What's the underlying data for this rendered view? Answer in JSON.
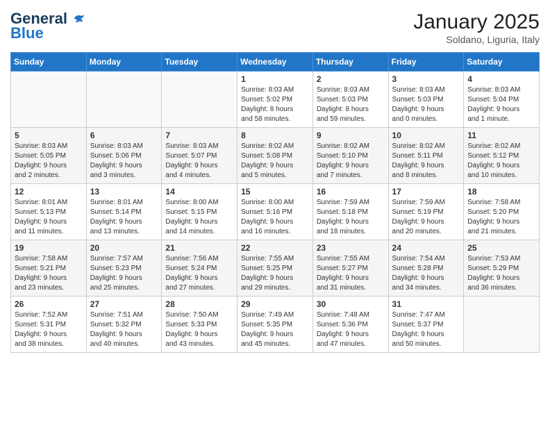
{
  "header": {
    "logo_general": "General",
    "logo_blue": "Blue",
    "month": "January 2025",
    "location": "Soldano, Liguria, Italy"
  },
  "weekdays": [
    "Sunday",
    "Monday",
    "Tuesday",
    "Wednesday",
    "Thursday",
    "Friday",
    "Saturday"
  ],
  "weeks": [
    [
      {
        "day": "",
        "info": ""
      },
      {
        "day": "",
        "info": ""
      },
      {
        "day": "",
        "info": ""
      },
      {
        "day": "1",
        "info": "Sunrise: 8:03 AM\nSunset: 5:02 PM\nDaylight: 8 hours\nand 58 minutes."
      },
      {
        "day": "2",
        "info": "Sunrise: 8:03 AM\nSunset: 5:03 PM\nDaylight: 8 hours\nand 59 minutes."
      },
      {
        "day": "3",
        "info": "Sunrise: 8:03 AM\nSunset: 5:03 PM\nDaylight: 9 hours\nand 0 minutes."
      },
      {
        "day": "4",
        "info": "Sunrise: 8:03 AM\nSunset: 5:04 PM\nDaylight: 9 hours\nand 1 minute."
      }
    ],
    [
      {
        "day": "5",
        "info": "Sunrise: 8:03 AM\nSunset: 5:05 PM\nDaylight: 9 hours\nand 2 minutes."
      },
      {
        "day": "6",
        "info": "Sunrise: 8:03 AM\nSunset: 5:06 PM\nDaylight: 9 hours\nand 3 minutes."
      },
      {
        "day": "7",
        "info": "Sunrise: 8:03 AM\nSunset: 5:07 PM\nDaylight: 9 hours\nand 4 minutes."
      },
      {
        "day": "8",
        "info": "Sunrise: 8:02 AM\nSunset: 5:08 PM\nDaylight: 9 hours\nand 5 minutes."
      },
      {
        "day": "9",
        "info": "Sunrise: 8:02 AM\nSunset: 5:10 PM\nDaylight: 9 hours\nand 7 minutes."
      },
      {
        "day": "10",
        "info": "Sunrise: 8:02 AM\nSunset: 5:11 PM\nDaylight: 9 hours\nand 8 minutes."
      },
      {
        "day": "11",
        "info": "Sunrise: 8:02 AM\nSunset: 5:12 PM\nDaylight: 9 hours\nand 10 minutes."
      }
    ],
    [
      {
        "day": "12",
        "info": "Sunrise: 8:01 AM\nSunset: 5:13 PM\nDaylight: 9 hours\nand 11 minutes."
      },
      {
        "day": "13",
        "info": "Sunrise: 8:01 AM\nSunset: 5:14 PM\nDaylight: 9 hours\nand 13 minutes."
      },
      {
        "day": "14",
        "info": "Sunrise: 8:00 AM\nSunset: 5:15 PM\nDaylight: 9 hours\nand 14 minutes."
      },
      {
        "day": "15",
        "info": "Sunrise: 8:00 AM\nSunset: 5:16 PM\nDaylight: 9 hours\nand 16 minutes."
      },
      {
        "day": "16",
        "info": "Sunrise: 7:59 AM\nSunset: 5:18 PM\nDaylight: 9 hours\nand 18 minutes."
      },
      {
        "day": "17",
        "info": "Sunrise: 7:59 AM\nSunset: 5:19 PM\nDaylight: 9 hours\nand 20 minutes."
      },
      {
        "day": "18",
        "info": "Sunrise: 7:58 AM\nSunset: 5:20 PM\nDaylight: 9 hours\nand 21 minutes."
      }
    ],
    [
      {
        "day": "19",
        "info": "Sunrise: 7:58 AM\nSunset: 5:21 PM\nDaylight: 9 hours\nand 23 minutes."
      },
      {
        "day": "20",
        "info": "Sunrise: 7:57 AM\nSunset: 5:23 PM\nDaylight: 9 hours\nand 25 minutes."
      },
      {
        "day": "21",
        "info": "Sunrise: 7:56 AM\nSunset: 5:24 PM\nDaylight: 9 hours\nand 27 minutes."
      },
      {
        "day": "22",
        "info": "Sunrise: 7:55 AM\nSunset: 5:25 PM\nDaylight: 9 hours\nand 29 minutes."
      },
      {
        "day": "23",
        "info": "Sunrise: 7:55 AM\nSunset: 5:27 PM\nDaylight: 9 hours\nand 31 minutes."
      },
      {
        "day": "24",
        "info": "Sunrise: 7:54 AM\nSunset: 5:28 PM\nDaylight: 9 hours\nand 34 minutes."
      },
      {
        "day": "25",
        "info": "Sunrise: 7:53 AM\nSunset: 5:29 PM\nDaylight: 9 hours\nand 36 minutes."
      }
    ],
    [
      {
        "day": "26",
        "info": "Sunrise: 7:52 AM\nSunset: 5:31 PM\nDaylight: 9 hours\nand 38 minutes."
      },
      {
        "day": "27",
        "info": "Sunrise: 7:51 AM\nSunset: 5:32 PM\nDaylight: 9 hours\nand 40 minutes."
      },
      {
        "day": "28",
        "info": "Sunrise: 7:50 AM\nSunset: 5:33 PM\nDaylight: 9 hours\nand 43 minutes."
      },
      {
        "day": "29",
        "info": "Sunrise: 7:49 AM\nSunset: 5:35 PM\nDaylight: 9 hours\nand 45 minutes."
      },
      {
        "day": "30",
        "info": "Sunrise: 7:48 AM\nSunset: 5:36 PM\nDaylight: 9 hours\nand 47 minutes."
      },
      {
        "day": "31",
        "info": "Sunrise: 7:47 AM\nSunset: 5:37 PM\nDaylight: 9 hours\nand 50 minutes."
      },
      {
        "day": "",
        "info": ""
      }
    ]
  ]
}
